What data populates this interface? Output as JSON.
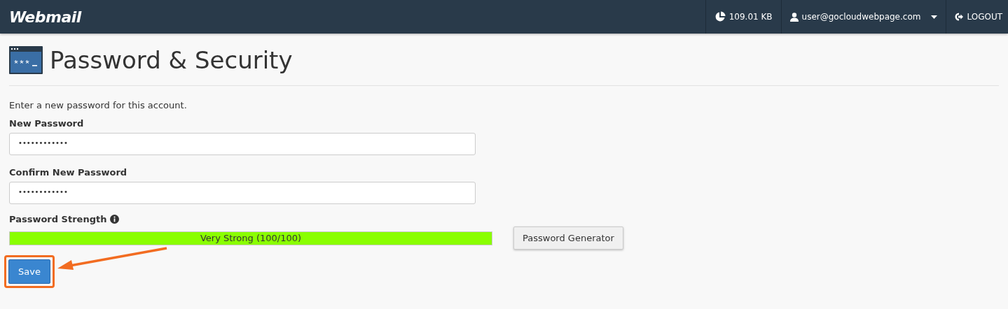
{
  "header": {
    "logo": "Webmail",
    "disk_usage": "109.01 KB",
    "user": "user@gocloudwebpage.com",
    "logout": "LOGOUT"
  },
  "page": {
    "title": "Password & Security"
  },
  "form": {
    "intro": "Enter a new password for this account.",
    "fields": [
      {
        "label": "New Password",
        "value": "••••••••••••"
      },
      {
        "label": "Confirm New Password",
        "value": "••••••••••••"
      }
    ],
    "strength": {
      "label": "Password Strength",
      "level": 1,
      "reading": "Very Strong (100/100)"
    },
    "generator_button": "Password Generator",
    "save_button": "Save",
    "save_highlighted": true
  }
}
